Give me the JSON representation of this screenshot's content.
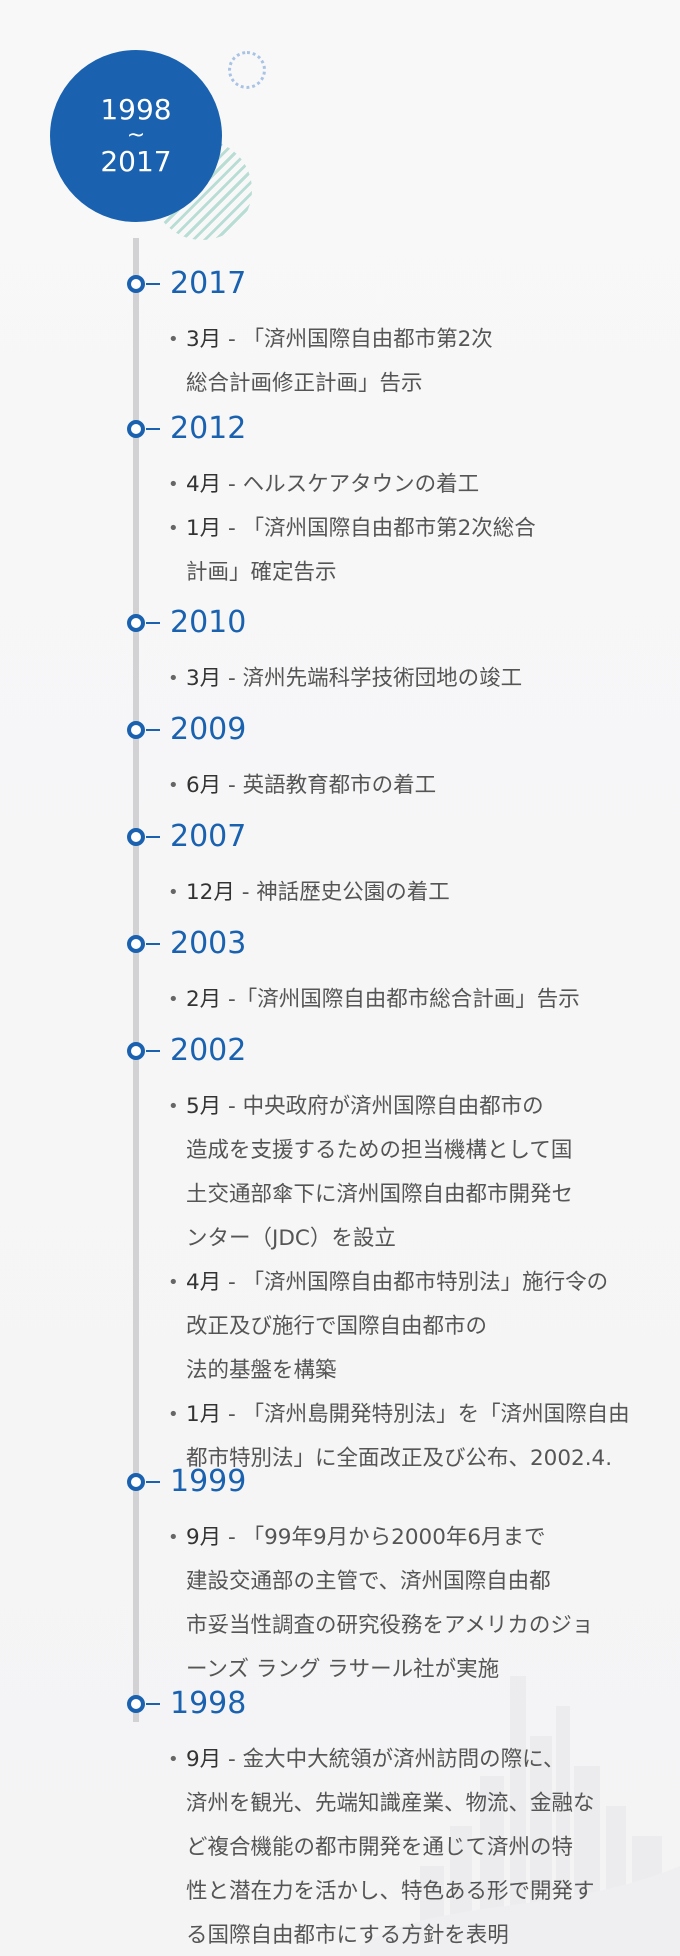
{
  "badge": {
    "from": "1998",
    "sep": "~",
    "to": "2017"
  },
  "entries": [
    {
      "year": "2017",
      "items": [
        {
          "month": "3月",
          "lines": [
            " - 「済州国際自由都市第2次",
            "総合計画修正計画」告示"
          ]
        }
      ]
    },
    {
      "year": "2012",
      "items": [
        {
          "month": "4月",
          "lines": [
            " - ヘルスケアタウンの着工"
          ]
        },
        {
          "month": "1月",
          "lines": [
            " - 「済州国際自由都市第2次総合",
            "計画」確定告示"
          ]
        }
      ]
    },
    {
      "year": "2010",
      "items": [
        {
          "month": "3月",
          "lines": [
            " - 済州先端科学技術団地の竣工"
          ]
        }
      ]
    },
    {
      "year": "2009",
      "items": [
        {
          "month": "6月",
          "lines": [
            " - 英語教育都市の着工"
          ]
        }
      ]
    },
    {
      "year": "2007",
      "items": [
        {
          "month": "12月",
          "lines": [
            " - 神話歴史公園の着工"
          ]
        }
      ]
    },
    {
      "year": "2003",
      "items": [
        {
          "month": "2月",
          "lines": [
            " -「済州国際自由都市総合計画」告示"
          ]
        }
      ]
    },
    {
      "year": "2002",
      "items": [
        {
          "month": "5月",
          "lines": [
            " - 中央政府が済州国際自由都市の",
            "造成を支援するための担当機構として国",
            "土交通部傘下に済州国際自由都市開発セ",
            "ンター（JDC）を設立"
          ]
        },
        {
          "month": "4月",
          "lines": [
            " - 「済州国際自由都市特別法」施行令の",
            "改正及び施行で国際自由都市の",
            "法的基盤を構築"
          ]
        },
        {
          "month": "1月",
          "lines": [
            " - 「済州島開発特別法」を「済州国際自由",
            "都市特別法」に全面改正及び公布、2002.4."
          ]
        }
      ]
    },
    {
      "year": "1999",
      "items": [
        {
          "month": "9月",
          "lines": [
            " - 「99年9月から2000年6月まで",
            "建設交通部の主管で、済州国際自由都",
            "市妥当性調査の研究役務をアメリカのジョ",
            "ーンズ ラング ラサール社が実施"
          ]
        }
      ]
    },
    {
      "year": "1998",
      "items": [
        {
          "month": "9月",
          "lines": [
            " - 金大中大統領が済州訪問の際に、",
            "済州を観光、先端知識産業、物流、金融な",
            "ど複合機能の都市開発を通じて済州の特",
            "性と潜在力を活かし、特色ある形で開発す",
            "る国際自由都市にする方針を表明"
          ]
        }
      ]
    }
  ]
}
